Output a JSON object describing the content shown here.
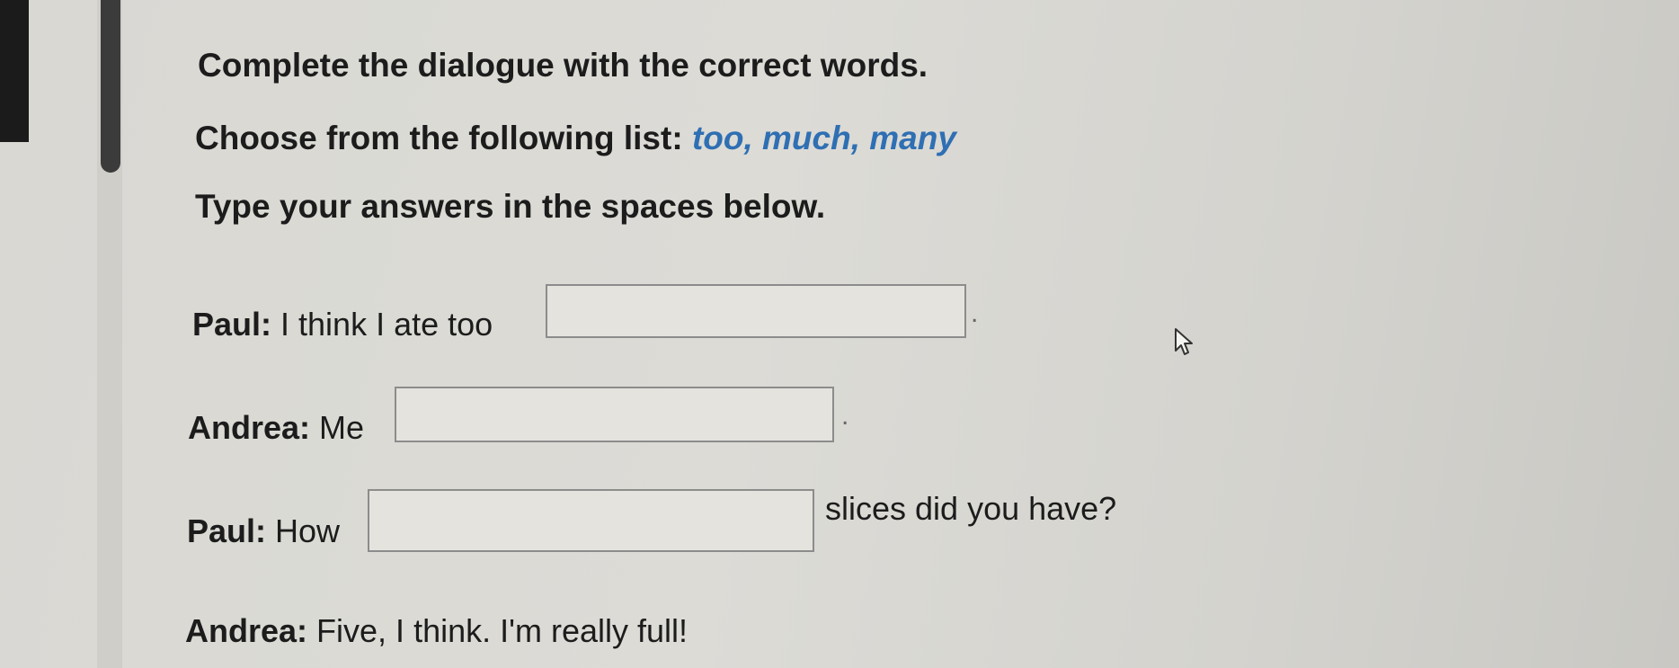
{
  "instructions": {
    "line1": "Complete the dialogue with the correct words.",
    "line2_prefix": "Choose from the following list:",
    "line2_choices": "too, much, many",
    "line3": "Type your answers in the spaces below."
  },
  "dialogue": [
    {
      "speaker": "Paul:",
      "before": "I think I ate too",
      "answer": "",
      "after": "."
    },
    {
      "speaker": "Andrea:",
      "before": "Me",
      "answer": "",
      "after": "."
    },
    {
      "speaker": "Paul:",
      "before": "How",
      "answer": "",
      "after": "slices did you have?"
    },
    {
      "speaker": "Andrea:",
      "text": "Five, I think. I'm really full!"
    }
  ],
  "icons": {
    "cursor": "pointer-cursor-icon"
  }
}
